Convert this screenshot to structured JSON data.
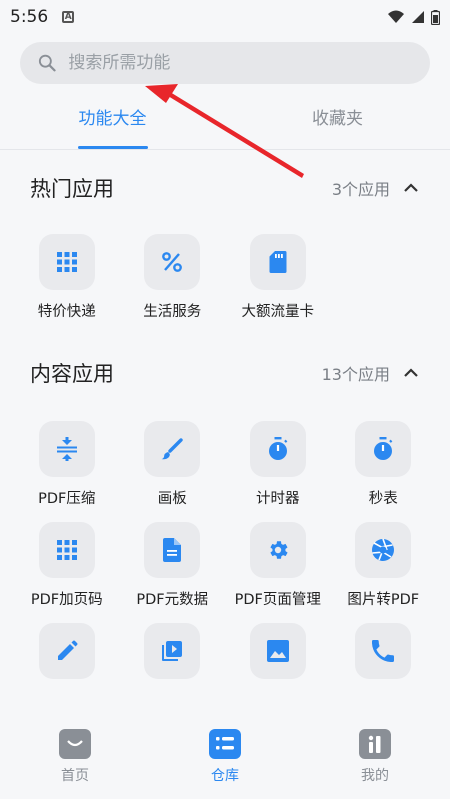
{
  "status_bar": {
    "time": "5:56",
    "a_badge": "A"
  },
  "search": {
    "placeholder": "搜索所需功能"
  },
  "tabs": [
    {
      "label": "功能大全",
      "active": true
    },
    {
      "label": "收藏夹",
      "active": false
    }
  ],
  "hot_section": {
    "title": "热门应用",
    "count": "3个应用",
    "apps": [
      {
        "label": "特价快递",
        "icon": "grid-icon"
      },
      {
        "label": "生活服务",
        "icon": "percent-icon"
      },
      {
        "label": "大额流量卡",
        "icon": "sim-card-icon"
      }
    ]
  },
  "content_section": {
    "title": "内容应用",
    "count": "13个应用",
    "apps": [
      {
        "label": "PDF压缩",
        "icon": "compress-icon"
      },
      {
        "label": "画板",
        "icon": "brush-icon"
      },
      {
        "label": "计时器",
        "icon": "timer-icon"
      },
      {
        "label": "秒表",
        "icon": "stopwatch-icon"
      },
      {
        "label": "PDF加页码",
        "icon": "grid-icon"
      },
      {
        "label": "PDF元数据",
        "icon": "document-icon"
      },
      {
        "label": "PDF页面管理",
        "icon": "gear-icon"
      },
      {
        "label": "图片转PDF",
        "icon": "aperture-icon"
      },
      {
        "label": "",
        "icon": "pencil-icon"
      },
      {
        "label": "",
        "icon": "video-library-icon"
      },
      {
        "label": "",
        "icon": "image-icon"
      },
      {
        "label": "",
        "icon": "phone-icon"
      }
    ]
  },
  "bottom_nav": [
    {
      "label": "首页",
      "icon": "bag-icon",
      "active": false
    },
    {
      "label": "仓库",
      "icon": "list-icon",
      "active": true
    },
    {
      "label": "我的",
      "icon": "profile-icon",
      "active": false
    }
  ],
  "colors": {
    "accent": "#2b88f0",
    "icon_bg": "#e9eaed",
    "arrow": "#e8262b"
  }
}
